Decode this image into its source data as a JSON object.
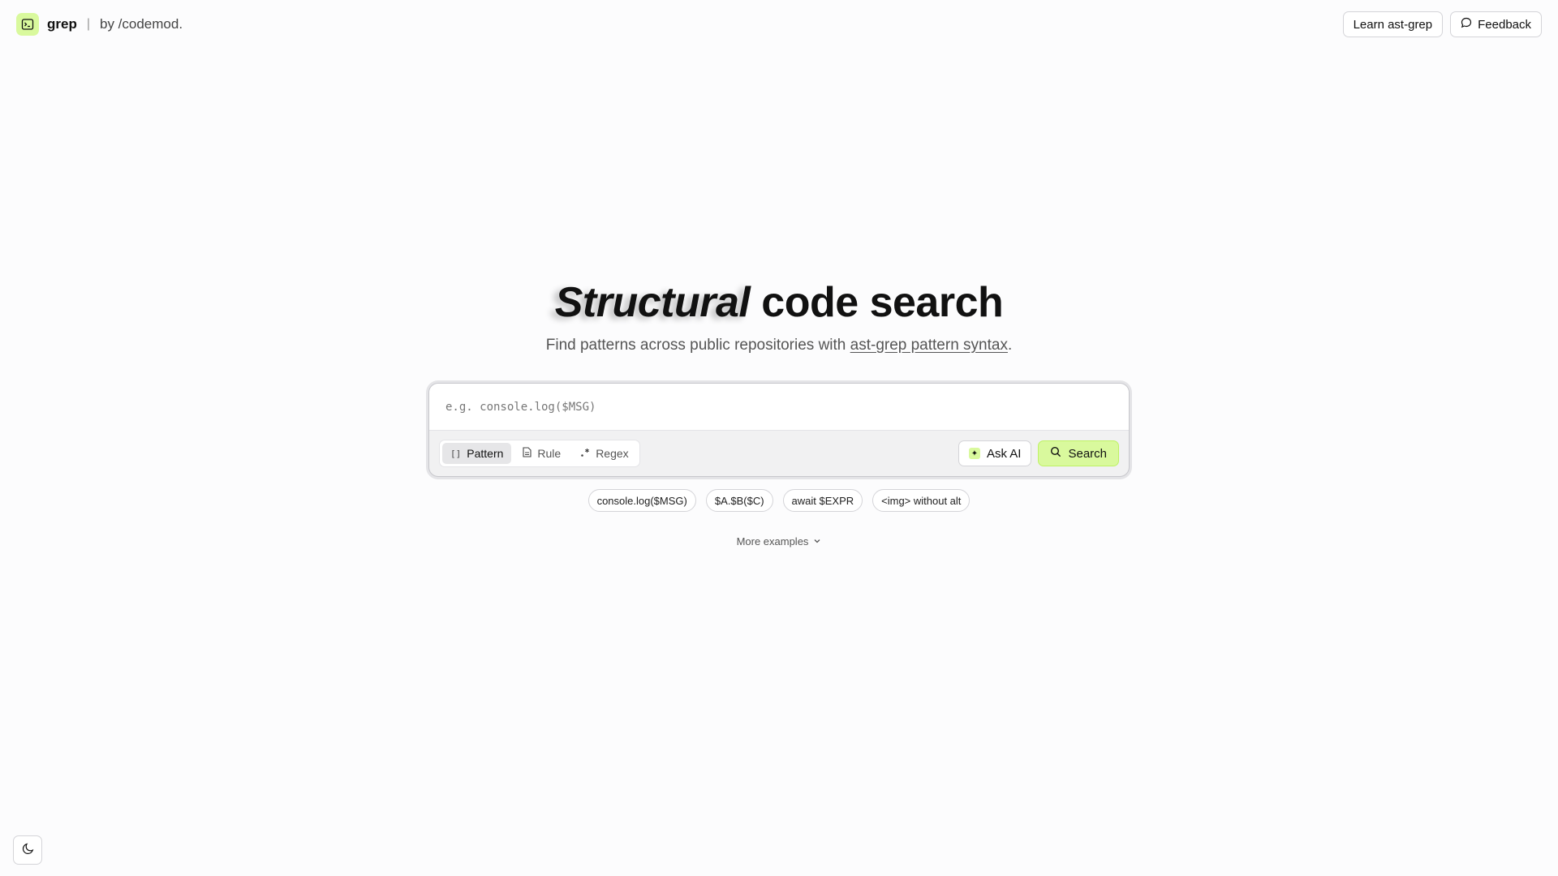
{
  "brand": {
    "name": "grep",
    "separator": "|",
    "by": "by /codemod."
  },
  "header": {
    "learn_label": "Learn ast-grep",
    "feedback_label": "Feedback"
  },
  "hero": {
    "title_emphasis": "Structural",
    "title_rest": " code search",
    "subtitle_prefix": "Find patterns across public repositories with ",
    "subtitle_link": "ast-grep pattern syntax",
    "subtitle_suffix": "."
  },
  "search": {
    "placeholder": "e.g. console.log($MSG)",
    "value": "",
    "modes": [
      {
        "label": "Pattern",
        "icon": "brackets-icon",
        "active": true
      },
      {
        "label": "Rule",
        "icon": "file-icon",
        "active": false
      },
      {
        "label": "Regex",
        "icon": "regex-icon",
        "active": false
      }
    ],
    "ask_ai_label": "Ask AI",
    "search_label": "Search"
  },
  "examples": [
    "console.log($MSG)",
    "$A.$B($C)",
    "await $EXPR",
    "<img> without alt"
  ],
  "more_examples_label": "More examples",
  "colors": {
    "accent": "#d9f99d",
    "background": "#fcfcfd"
  }
}
